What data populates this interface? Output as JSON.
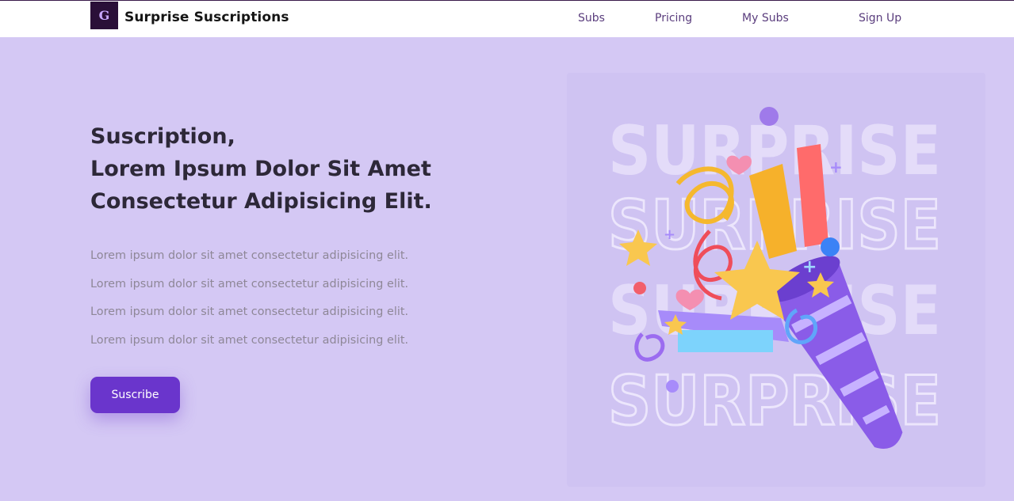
{
  "header": {
    "brand": "Surprise Suscriptions",
    "logo_icon": "gift-logo-icon",
    "nav": [
      {
        "label": "Subs"
      },
      {
        "label": "Pricing"
      },
      {
        "label": "My Subs"
      },
      {
        "label": "Sign Up"
      }
    ]
  },
  "hero": {
    "title_lines": [
      "Suscription,",
      "Lorem Ipsum Dolor Sit Amet",
      "Consectetur Adipisicing Elit."
    ],
    "paragraph_lines": [
      "Lorem ipsum dolor sit amet consectetur adipisicing elit.",
      "Lorem ipsum dolor sit amet consectetur adipisicing elit.",
      "Lorem ipsum dolor sit amet consectetur adipisicing elit.",
      "Lorem ipsum dolor sit amet consectetur adipisicing elit."
    ],
    "cta_label": "Suscribe",
    "image": {
      "name": "party-popper-illustration",
      "watermark_text": "SURPRISE"
    }
  },
  "colors": {
    "background": "#d4c8f4",
    "accent": "#6a35cc",
    "title": "#2d2838",
    "nav_text": "#5a3d7d"
  }
}
